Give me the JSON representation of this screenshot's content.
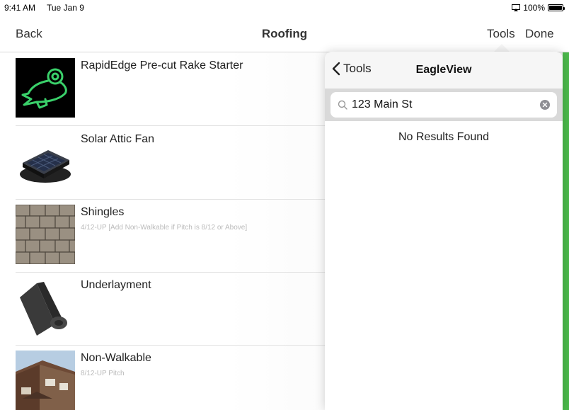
{
  "status": {
    "time": "9:41 AM",
    "date": "Tue Jan 9",
    "battery": "100%"
  },
  "nav": {
    "back": "Back",
    "title": "Roofing",
    "tools": "Tools",
    "done": "Done"
  },
  "items": [
    {
      "title": "RapidEdge Pre-cut Rake Starter",
      "subtitle": "",
      "thumb_icon": "frog-logo"
    },
    {
      "title": "Solar Attic Fan",
      "subtitle": "",
      "thumb_icon": "solar-fan"
    },
    {
      "title": "Shingles",
      "subtitle": "4/12-UP [Add Non-Walkable if Pitch is 8/12 or Above]",
      "thumb_icon": "shingles"
    },
    {
      "title": "Underlayment",
      "subtitle": "",
      "thumb_icon": "underlayment-roll"
    },
    {
      "title": "Non-Walkable",
      "subtitle": "8/12-UP Pitch",
      "thumb_icon": "roof-house"
    }
  ],
  "popover": {
    "back_label": "Tools",
    "title": "EagleView",
    "search_value": "123 Main St",
    "empty_text": "No Results Found"
  },
  "colors": {
    "accent_green": "#4bb94b",
    "frog_green": "#3ad06a"
  }
}
